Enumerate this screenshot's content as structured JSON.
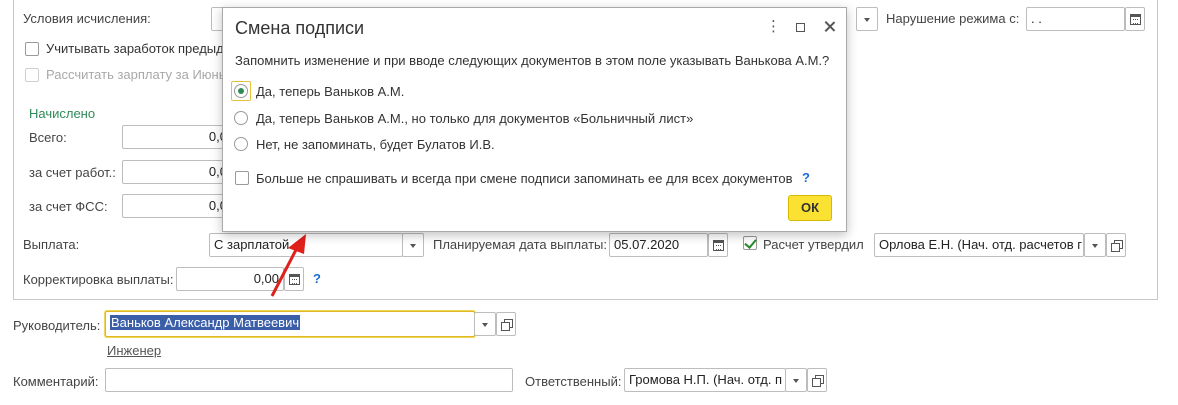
{
  "form": {
    "conditions_label": "Условия исчисления:",
    "violation_label": "Нарушение режима с:",
    "violation_value": " .  .",
    "consider_earnings_label": "Учитывать заработок предыд",
    "calc_salary_label": "Рассчитать зарплату за Июнь",
    "accrued_header": "Начислено",
    "total_label": "Всего:",
    "total_value": "0,0",
    "employer_label": "за счет работ.:",
    "employer_value": "0,0",
    "fss_label": "за счет ФСС:",
    "fss_value": "0,0",
    "payment_label": "Выплата:",
    "payment_value": "С зарплатой",
    "planned_date_label": "Планируемая дата выплаты:",
    "planned_date_value": "05.07.2020",
    "approved_label": "Расчет утвердил",
    "approved_value": "Орлова Е.Н. (Нач. отд. расчетов г",
    "correction_label": "Корректировка выплаты:",
    "correction_value": "0,00",
    "help_mark": "?",
    "manager_label": "Руководитель:",
    "manager_value": "Ваньков Александр Матвеевич",
    "manager_position": "Инженер",
    "comment_label": "Комментарий:",
    "comment_value": "",
    "responsible_label": "Ответственный:",
    "responsible_value": "Громова Н.П. (Нач. отд. п"
  },
  "dialog": {
    "title": "Смена подписи",
    "question": "Запомнить изменение и при вводе следующих документов в этом поле указывать Ванькова А.М.?",
    "options": [
      {
        "label": "Да, теперь Ваньков А.М.",
        "selected": true
      },
      {
        "label": "Да, теперь Ваньков А.М., но только для документов «Больничный лист»",
        "selected": false
      },
      {
        "label": "Нет, не запоминать, будет Булатов И.В.",
        "selected": false
      }
    ],
    "dont_ask_label": "Больше не спрашивать и всегда при смене подписи запоминать ее для всех документов",
    "help_mark": "?",
    "ok_label": "ОК"
  },
  "colors": {
    "accent_yellow": "#fbe232",
    "accent_green": "#2e8b57",
    "selection_blue": "#3b5ea8",
    "arrow_red": "#e0201b"
  }
}
